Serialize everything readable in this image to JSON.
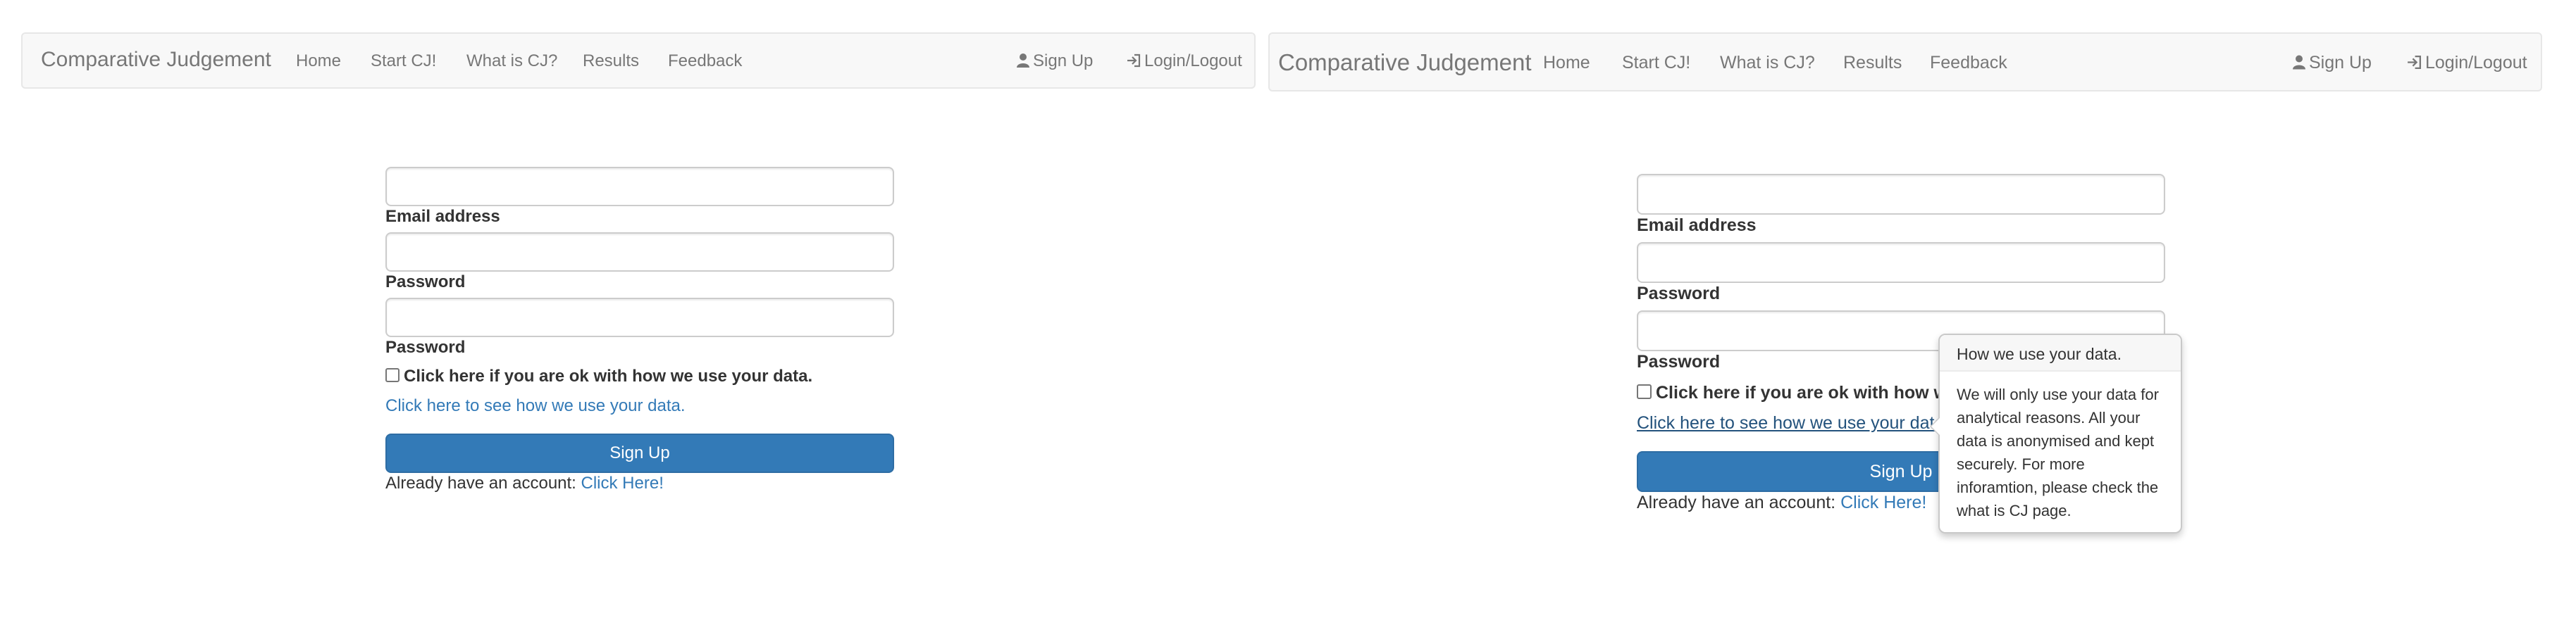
{
  "left": {
    "navbar": {
      "brand": "Comparative Judgement",
      "links": [
        "Home",
        "Start CJ!",
        "What is CJ?",
        "Results",
        "Feedback"
      ],
      "signup_label": "Sign Up",
      "login_label": "Login/Logout",
      "signup_icon": "user-icon",
      "login_icon": "login-icon"
    },
    "form": {
      "email_label": "Email address",
      "password_label": "Password",
      "confirm_label": "Password",
      "consent_label": "Click here if you are ok with how we use your data.",
      "data_link": "Click here to see how we use your data.",
      "submit_label": "Sign Up",
      "account_prefix": "Already have an account:",
      "account_link": "Click Here!"
    }
  },
  "right": {
    "navbar": {
      "brand": "Comparative Judgement",
      "links": [
        "Home",
        "Start CJ!",
        "What is CJ?",
        "Results",
        "Feedback"
      ],
      "signup_label": "Sign Up",
      "login_label": "Login/Logout",
      "signup_icon": "user-icon",
      "login_icon": "login-icon"
    },
    "form": {
      "email_label": "Email address",
      "password_label": "Password",
      "confirm_label": "Password",
      "consent_label": "Click here if you are ok with how we use your data.",
      "data_link": "Click here to see how we use your data.",
      "submit_label": "Sign Up",
      "account_prefix": "Already have an account:",
      "account_link": "Click Here!"
    },
    "popover": {
      "title": "How we use your data.",
      "content": "We will only use your data for analytical reasons. All your data is anonymised and kept securely. For more inforamtion, please check the what is CJ page."
    }
  },
  "colors": {
    "accent": "#337ab7",
    "navbar_bg": "#f8f8f8",
    "nav_text": "#777777"
  }
}
